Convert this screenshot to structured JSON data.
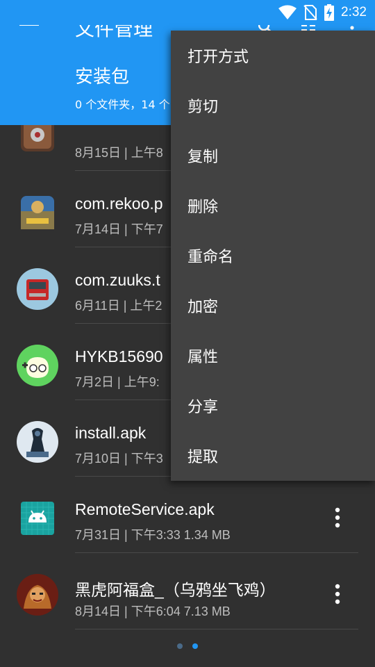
{
  "status_bar": {
    "time": "2:32",
    "icons": [
      "wifi-icon",
      "no-sim-icon",
      "battery-charging-icon"
    ],
    "background": "#2196f3"
  },
  "toolbar": {
    "title": "文件管理",
    "icons": [
      "menu-icon",
      "search-icon",
      "grid-view-icon",
      "more-vert-icon"
    ]
  },
  "folder": {
    "title": "安装包",
    "summary": "0 个文件夹，14 个"
  },
  "files": [
    {
      "name": "",
      "meta": "8月15日 | 上午8",
      "icon": "game-icon"
    },
    {
      "name": "com.rekoo.p",
      "meta": "7月14日 | 下午7",
      "icon": "pubg-icon"
    },
    {
      "name": "com.zuuks.t",
      "meta": "6月11日 | 上午2",
      "icon": "truck-icon"
    },
    {
      "name": "HYKB15690",
      "meta": "7月2日 | 上午9:",
      "icon": "gamepad-mascot-icon"
    },
    {
      "name": "install.apk",
      "meta": "7月10日 | 下午3",
      "icon": "robot-icon"
    },
    {
      "name": "RemoteService.apk",
      "meta": "7月31日 | 下午3:33   1.34 MB",
      "icon": "android-icon"
    },
    {
      "name": "黑虎阿福盒_（乌鸦坐飞鸡）",
      "meta": "8月14日 | 下午6:04   7.13 MB",
      "icon": "tiger-warrior-icon"
    }
  ],
  "context_menu": {
    "items": [
      "打开方式",
      "剪切",
      "复制",
      "删除",
      "重命名",
      "加密",
      "属性",
      "分享",
      "提取"
    ]
  },
  "colors": {
    "accent": "#2196f3",
    "background": "#303030",
    "menu_background": "#424242"
  }
}
